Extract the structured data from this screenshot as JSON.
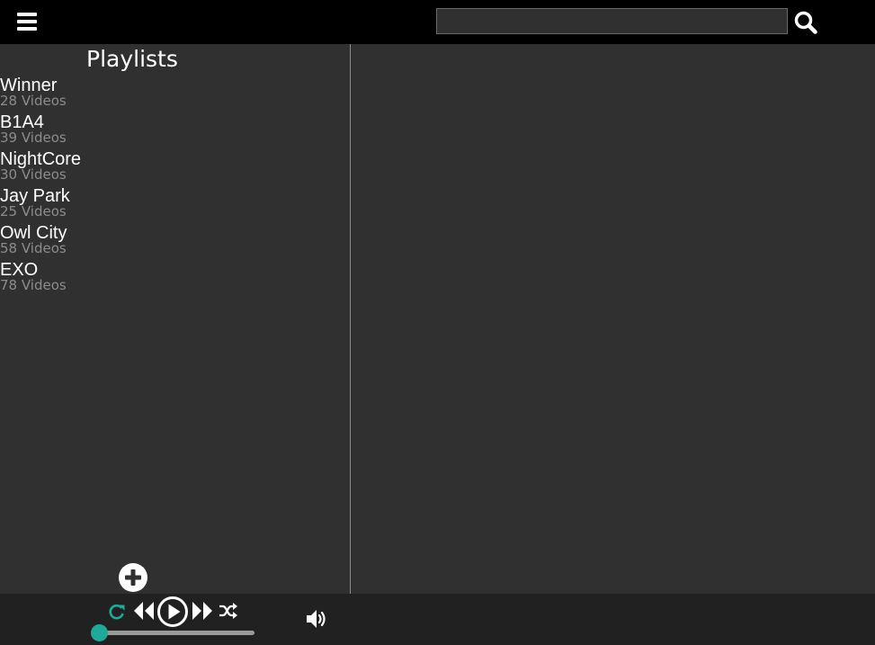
{
  "search": {
    "value": "",
    "placeholder": ""
  },
  "sidebar": {
    "title": "Playlists",
    "playlists": [
      {
        "name": "Winner",
        "count": "28 Videos"
      },
      {
        "name": "B1A4",
        "count": "39 Videos"
      },
      {
        "name": "NightCore",
        "count": "30 Videos"
      },
      {
        "name": "Jay Park",
        "count": "25 Videos"
      },
      {
        "name": "Owl City",
        "count": "58 Videos"
      },
      {
        "name": "EXO",
        "count": "78 Videos"
      }
    ]
  },
  "player": {
    "progress": 0,
    "controls": [
      "repeat-icon",
      "rewind-icon",
      "play-icon",
      "fast-forward-icon",
      "shuffle-icon",
      "volume-icon"
    ]
  },
  "icons": {
    "menu": "menu-icon",
    "search": "search-icon",
    "add": "plus-circle-icon"
  },
  "colors": {
    "topbar": "#000000",
    "background": "#303030",
    "bottombar": "#212121",
    "accent": "#1fa99b",
    "muted_text": "#8c8c8c"
  }
}
